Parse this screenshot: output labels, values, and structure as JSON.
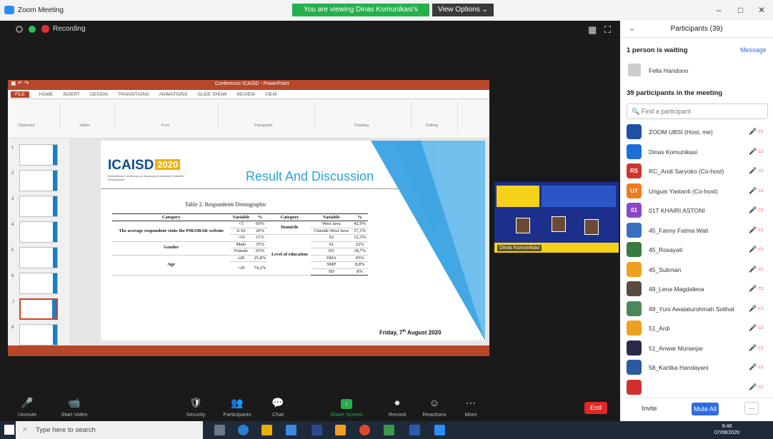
{
  "window": {
    "title": "Zoom Meeting",
    "share_banner": "You are viewing Dinas Komunikasi's screen",
    "view_options": "View Options",
    "controls": [
      "–",
      "□",
      "✕"
    ]
  },
  "meeting_top": {
    "recording_label": "Recording"
  },
  "slide": {
    "doc_title": "Conference ICAISD - PowerPoint",
    "tabs": [
      "FILE",
      "HOME",
      "INSERT",
      "DESIGN",
      "TRANSITIONS",
      "ANIMATIONS",
      "SLIDE SHOW",
      "REVIEW",
      "VIEW"
    ],
    "ribbon_groups": [
      "Clipboard",
      "Slides",
      "Font",
      "Paragraph",
      "Drawing",
      "Editing"
    ],
    "logo": "ICAISD",
    "logo_year": "2020",
    "logo_sub": "International Conference on Advanced Information Scientific Development",
    "heading": "Result And Discussion",
    "caption": "Table 2. Respondents Demographic",
    "date": "Friday, 7",
    "date_sup": "th",
    "date_rest": " August 2020",
    "table": {
      "headers": [
        "Category",
        "Variable",
        "%",
        "Category",
        "Variable",
        "%"
      ],
      "rows": [
        [
          "The average respondent visits the PIKOBAR website",
          "<5",
          "69%",
          "Domicile",
          "West Java",
          "42,9%"
        ],
        [
          "",
          "6-10",
          "20%",
          "",
          "Outside West Java",
          "57,1%"
        ],
        [
          "",
          ">10",
          "11%",
          "Level of education",
          "S2",
          "12,3%"
        ],
        [
          "Gender",
          "Male",
          "35%",
          "",
          "S1",
          "22%"
        ],
        [
          "",
          "Female",
          "65%",
          "",
          "D3",
          "18,7%"
        ],
        [
          "Age",
          "≤20",
          "25,8%",
          "",
          "SMA",
          "45%"
        ],
        [
          "",
          ">20",
          "74,2%",
          "",
          "SMP",
          "8,8%"
        ],
        [
          "",
          "",
          "",
          "",
          "SD",
          "8%"
        ]
      ]
    }
  },
  "video": {
    "name": "Dinas Komunikasi"
  },
  "controls": [
    {
      "label": "Unmute",
      "icon": "🎤"
    },
    {
      "label": "Start Video",
      "icon": "📹"
    },
    {
      "label": "Security",
      "icon": "🛡"
    },
    {
      "label": "Participants",
      "icon": "👥"
    },
    {
      "label": "Chat",
      "icon": "💬"
    },
    {
      "label": "Share Screen",
      "icon": "↑"
    },
    {
      "label": "Record",
      "icon": "⏺"
    },
    {
      "label": "Reactions",
      "icon": "☺"
    },
    {
      "label": "More",
      "icon": "⋯"
    }
  ],
  "end_label": "End",
  "participants": {
    "title": "Participants (39)",
    "waiting": "1 person is waiting",
    "message": "Message",
    "waiting_name": "Fella Handono",
    "in_meeting": "39 participants in the meeting",
    "search_placeholder": "Find a participant",
    "list": [
      {
        "name": "ZOOM UBSI (Host, me)",
        "initials": "",
        "color": "#1f4fa8"
      },
      {
        "name": "Dinas Komunikasi",
        "initials": "",
        "color": "#1f6fd8"
      },
      {
        "name": "RC_Andi Saryoko (Co-host)",
        "initials": "RS",
        "color": "#d0342c"
      },
      {
        "name": "Unguis Yastanti (Co-host)",
        "initials": "UY",
        "color": "#f07a1e"
      },
      {
        "name": "01T KHAIRI ASTONI",
        "initials": "01",
        "color": "#8a48c8"
      },
      {
        "name": "45_Fanny Fatma Wati",
        "initials": "",
        "color": "#3a6fc0"
      },
      {
        "name": "45_Rosayati",
        "initials": "",
        "color": "#3a7a40"
      },
      {
        "name": "45_Sukman",
        "initials": "",
        "color": "#f0a020"
      },
      {
        "name": "49_Lena Magdalena",
        "initials": "",
        "color": "#5a4a40"
      },
      {
        "name": "49_Yuni Awalaturohmah Solihat",
        "initials": "",
        "color": "#4a8a5a"
      },
      {
        "name": "51_Ardi",
        "initials": "",
        "color": "#f0a020"
      },
      {
        "name": "51_Anwar Munanjar",
        "initials": "",
        "color": "#2a2a4a"
      },
      {
        "name": "58_Kartika Handayani",
        "initials": "",
        "color": "#2a5aa0"
      },
      {
        "name": "",
        "initials": "",
        "color": "#d03030"
      }
    ],
    "invite": "Invite",
    "mute_all": "Mute All",
    "more": "..."
  },
  "taskbar": {
    "search_placeholder": "Type here to search",
    "time": "8:48",
    "date": "07/08/2020"
  }
}
